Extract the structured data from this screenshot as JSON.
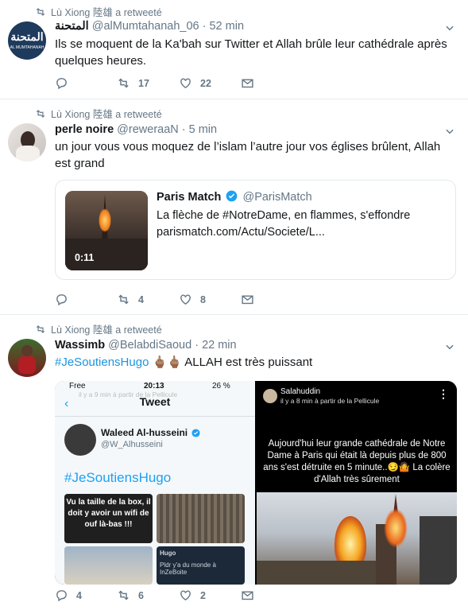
{
  "tweets": [
    {
      "retweet_label": "Lù Xiong 陸雄 a retweeté",
      "name": "المتحنة",
      "handle": "@alMumtahanah_06",
      "time": "· 52 min",
      "avatar_text": "AL MUMTAHANAH",
      "text": "Ils se moquent de la Ka'bah sur Twitter et Allah brûle leur cathédrale après quelques heures.",
      "replies": "",
      "retweets": "17",
      "likes": "22"
    },
    {
      "retweet_label": "Lù Xiong 陸雄 a retweeté",
      "name": "perle noire",
      "handle": "@reweraaN",
      "time": "· 5 min",
      "text": "un jour vous vous moquez de l’islam l’autre jour vos églises brûlent, Allah est grand",
      "card": {
        "name": "Paris Match",
        "handle": "@ParisMatch",
        "desc": "La flèche de #NotreDame, en flammes, s'effondre",
        "link": "parismatch.com/Actu/Societe/L...",
        "duration": "0:11"
      },
      "replies": "",
      "retweets": "4",
      "likes": "8"
    },
    {
      "retweet_label": "Lù Xiong 陸雄 a retweeté",
      "name": "Wassimb",
      "handle": "@BelabdiSaoud",
      "time": "· 22 min",
      "hashtag": "#JeSoutiensHugo",
      "emoji": "🖕🏽🖕🏽",
      "text_after": " ALLAH est très puissant",
      "media_left": {
        "status_carrier": "Free",
        "status_time": "20:13",
        "status_battery": "26 %",
        "overlay": "il y a 9 min à partir de la Pellicule",
        "title": "Tweet",
        "name": "Waleed Al-husseini",
        "handle": "@W_Alhusseini",
        "hashtag": "#JeSoutiensHugo",
        "img_text": "Vu la taille de la box, il doit y avoir un wifi de ouf là-bas !!!",
        "reply_name": "Hugo",
        "reply_text": "Pldr y'a du monde à InZeBoite"
      },
      "media_right": {
        "name": "Salahuddin",
        "sub": "il y a 8 min à partir de la Pellicule",
        "text": "Aujourd'hui leur grande cathédrale de Notre Dame à Paris qui était là depuis plus de 800 ans s'est détruite en 5 minute..😏🤷 La colère d'Allah très sûrement"
      },
      "replies": "4",
      "retweets": "6",
      "likes": "2"
    }
  ],
  "colors": {
    "accent": "#1da1f2",
    "muted": "#657786",
    "border": "#e6ecf0"
  },
  "icons": [
    "retweet-icon",
    "chevron-down-icon",
    "reply-icon",
    "like-icon",
    "message-icon",
    "verified-icon"
  ]
}
